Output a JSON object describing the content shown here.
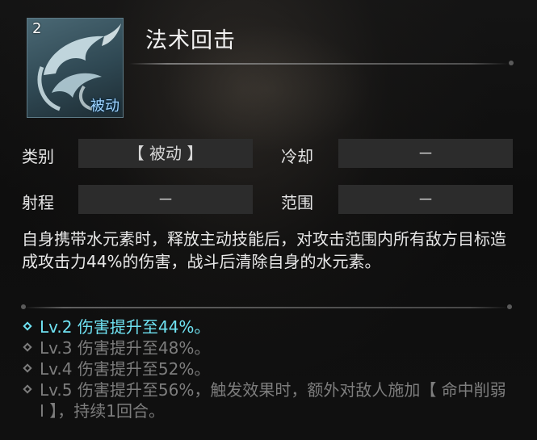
{
  "skill": {
    "level": "2",
    "type_badge": "被动",
    "title": "法术回击",
    "icon_name": "water-swirl-skill-icon"
  },
  "attributes": {
    "category_label": "类别",
    "category_value": "【 被动 】",
    "cooldown_label": "冷却",
    "cooldown_value": "－",
    "range_label": "射程",
    "range_value": "－",
    "area_label": "范围",
    "area_value": "－"
  },
  "description": "自身携带水元素时，释放主动技能后，对攻击范围内所有敌方目标造成攻击力44%的伤害，战斗后清除自身的水元素。",
  "levels": [
    {
      "text": "Lv.2 伤害提升至44%。",
      "active": true
    },
    {
      "text": "Lv.3 伤害提升至48%。",
      "active": false
    },
    {
      "text": "Lv.4 伤害提升至52%。",
      "active": false
    },
    {
      "text": "Lv.5 伤害提升至56%，触发效果时，额外对敌人施加【 命中削弱 Ⅰ 】，持续1回合。",
      "active": false
    }
  ],
  "colors": {
    "active_level": "#6fe2f2",
    "inactive_level": "#7d7d7d",
    "type_badge": "#9fd3ff",
    "attr_box_bg": "#2c2c2c"
  }
}
